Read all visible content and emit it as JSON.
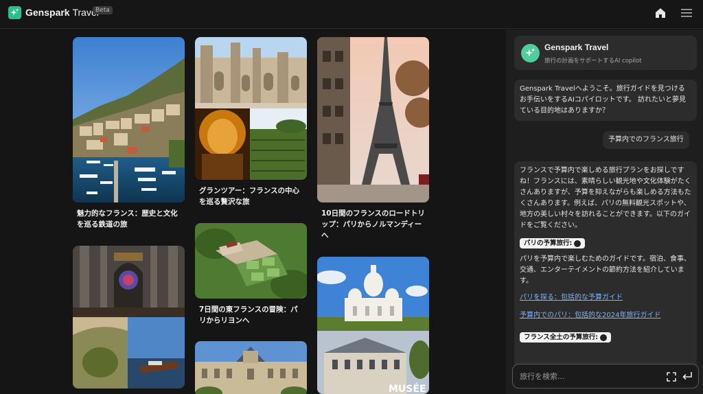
{
  "header": {
    "app_name": "Genspark",
    "app_name_suffix": "Travel",
    "beta_badge": "Beta",
    "icons": [
      "sparkle-logo-icon",
      "home-icon",
      "hamburger-menu-icon"
    ]
  },
  "gallery": {
    "cards": [
      {
        "caption": "魅力的なフランス：歴史と文化を巡る鉄道の旅",
        "image": "monaco-harbor"
      },
      {
        "caption": "グランツアー：フランスの中心を巡る贅沢な旅",
        "image": "palace-and-wine-cellar"
      },
      {
        "caption": "10日間のフランスのロードトリップ：パリからノルマンディーへ",
        "image": "eiffel-tower"
      },
      {
        "caption": "",
        "image": "cathedral-interior"
      },
      {
        "caption": "7日間の東フランスの冒険：パリからリヨンへ",
        "image": "chateau-aerial"
      },
      {
        "caption": "",
        "image": "sacre-coeur"
      },
      {
        "caption": "",
        "image": "luxembourg-palace"
      }
    ],
    "musee_text": "MUSÉE"
  },
  "panel": {
    "copilot": {
      "name": "Genspark Travel",
      "subtitle": "旅行の計画をサポートするAI copilot"
    },
    "messages": {
      "welcome": "Genspark Travelへようこそ。旅行ガイドを見つけるお手伝いをするAIコパイロットです。 訪れたいと夢見ている目的地はありますか？",
      "user_query": "予算内でのフランス旅行",
      "reply_intro": "フランスで予算内で楽しめる旅行プランをお探しですね！フランスには、素晴らしい観光地や文化体験がたくさんありますが、予算を抑えながらも楽しめる方法もたくさんあります。例えば、パリの無料観光スポットや、地方の美しい村々を訪れることができます。以下のガイドをご覧ください。",
      "tag_paris": "パリの予算旅行:",
      "paris_desc": "パリを予算内で楽しむためのガイドです。宿泊、食事、交通、エンターテイメントの節約方法を紹介しています。",
      "link_1": "パリを探る：包括的な予算ガイド",
      "link_2": "予算内でのパリ：包括的な2024年旅行ガイド",
      "tag_france": "フランス全土の予算旅行:"
    },
    "search": {
      "placeholder": "旅行を検索..."
    }
  }
}
